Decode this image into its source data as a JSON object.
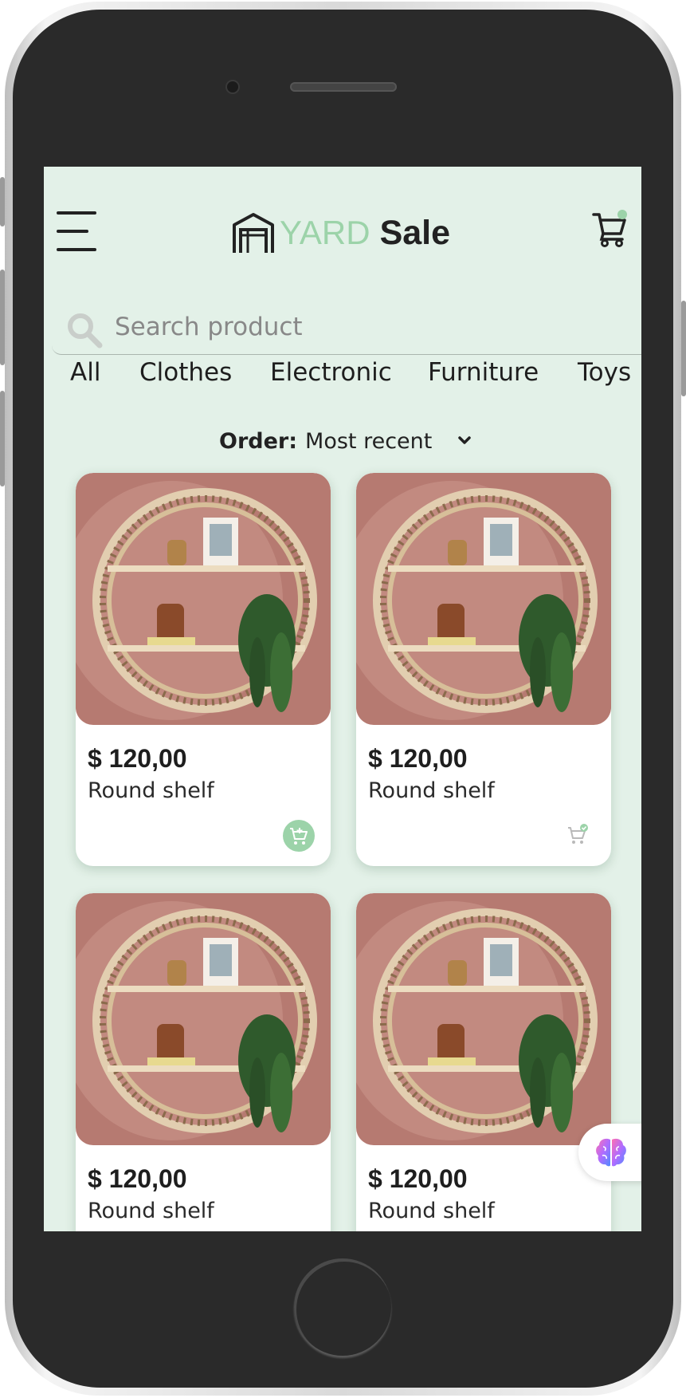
{
  "brand": {
    "word_a": "YARD",
    "word_b": "Sale",
    "accent_color": "#9cd3a9",
    "dark_color": "#222222"
  },
  "search": {
    "placeholder": "Search product",
    "value": ""
  },
  "categories": [
    "All",
    "Clothes",
    "Electronic",
    "Furniture",
    "Toys"
  ],
  "order": {
    "label": "Order:",
    "selected": "Most recent"
  },
  "products": [
    {
      "price": "$ 120,00",
      "name": "Round shelf",
      "cart_state": "add",
      "image": "round-shelf-photo"
    },
    {
      "price": "$ 120,00",
      "name": "Round shelf",
      "cart_state": "added",
      "image": "round-shelf-photo"
    },
    {
      "price": "$ 120,00",
      "name": "Round shelf",
      "cart_state": "add",
      "image": "round-shelf-photo"
    },
    {
      "price": "$ 120,00",
      "name": "Round shelf",
      "cart_state": "add",
      "image": "round-shelf-photo"
    }
  ],
  "icons": {
    "menu": "menu-icon",
    "cart": "cart-icon",
    "search": "search-icon",
    "chevron": "chevron-down-icon",
    "assistant": "brain-icon"
  },
  "colors": {
    "screen_background": "#e3f1e8",
    "card_background": "#ffffff",
    "cart_notification_dot": "#9cd3a9"
  }
}
